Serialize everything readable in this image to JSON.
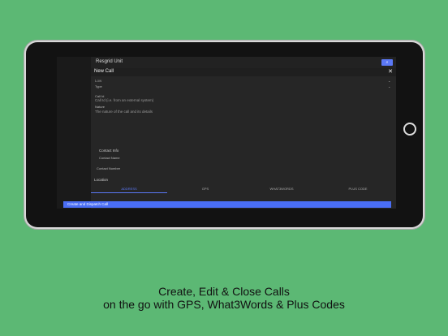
{
  "app": {
    "title": "Resgrid Unit"
  },
  "dialog": {
    "title": "New Call",
    "fields": {
      "priority": {
        "value": "Low"
      },
      "type": {
        "label": "Type"
      },
      "call_id": {
        "label": "Call Id",
        "placeholder": "Call Id (i.e. from an external system)"
      },
      "nature": {
        "label": "Nature",
        "placeholder": "The nature of the call and its details"
      }
    },
    "sections": {
      "contact_info": "Contact Info",
      "contact_name": "Contact Name",
      "contact_number": "Contact Number",
      "location": "Location"
    },
    "tabs": [
      "ADDRESS",
      "GPS",
      "WHAT3WORDS",
      "PLUS CODE"
    ],
    "submit_label": "Create and Dispatch Call"
  },
  "caption": {
    "line1": "Create, Edit & Close Calls",
    "line2": "on the go with GPS, What3Words & Plus Codes"
  },
  "colors": {
    "background": "#5cb874",
    "accent": "#5b78f6",
    "button": "#4a6ef5"
  },
  "icons": {
    "close": "close-icon",
    "dropdown": "chevron-down-icon"
  }
}
